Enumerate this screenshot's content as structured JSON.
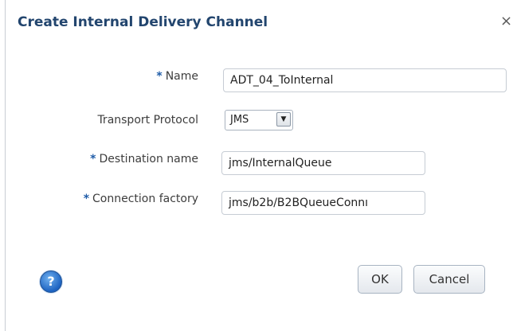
{
  "dialog": {
    "title": "Create Internal Delivery Channel",
    "close_glyph": "×"
  },
  "form": {
    "required_marker": "*",
    "name": {
      "label": "Name",
      "value": "ADT_04_ToInternal",
      "required": true
    },
    "transport_protocol": {
      "label": "Transport Protocol",
      "selected": "JMS"
    },
    "destination_name": {
      "label": "Destination name",
      "value": "jms/InternalQueue",
      "required": true
    },
    "connection_factory": {
      "label": "Connection factory",
      "value": "jms/b2b/B2BQueueConnı",
      "required": true
    }
  },
  "footer": {
    "help_glyph": "?",
    "ok_label": "OK",
    "cancel_label": "Cancel"
  },
  "icons": [
    "close-icon",
    "dropdown-arrow-icon",
    "help-icon"
  ],
  "colors": {
    "title": "#22456e",
    "required_marker": "#1f5ca8",
    "help_icon": "#1d63c1"
  }
}
